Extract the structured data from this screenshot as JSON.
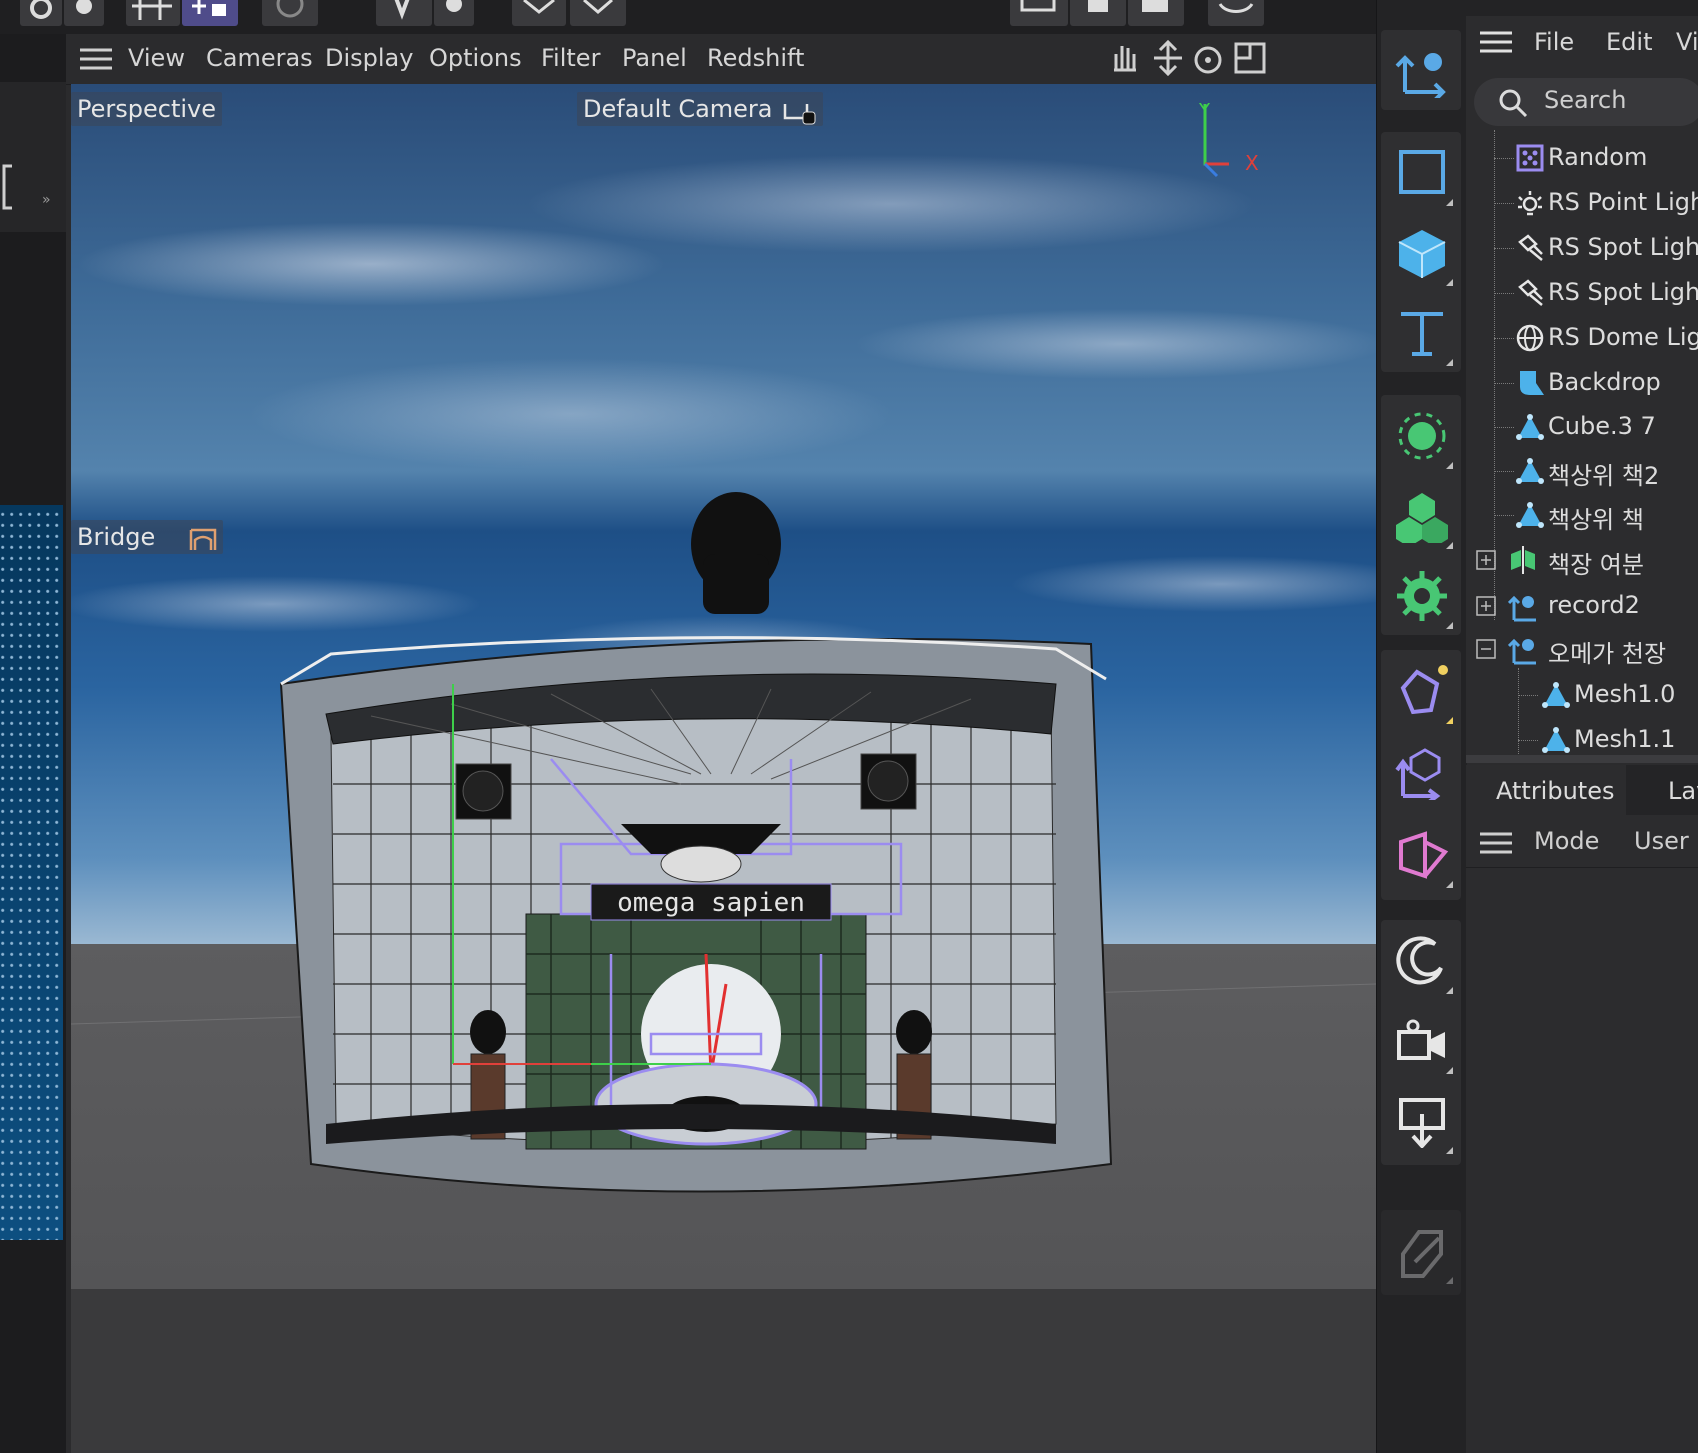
{
  "viewport_menu": {
    "items": [
      "View",
      "Cameras",
      "Display",
      "Options",
      "Filter",
      "Panel",
      "Redshift"
    ]
  },
  "viewport": {
    "projection_label": "Perspective",
    "camera_label": "Default Camera",
    "axis_y": "Y",
    "axis_x": "X",
    "bridge_label": "Bridge",
    "sign_text": "omega sapien"
  },
  "objects_panel": {
    "menu": {
      "file": "File",
      "edit": "Edit",
      "view": "Vi"
    },
    "search_placeholder": "Search",
    "items": [
      {
        "label": "Random",
        "icon": "random-icon"
      },
      {
        "label": "RS Point Ligh",
        "icon": "point-light-icon"
      },
      {
        "label": "RS Spot Light",
        "icon": "spot-light-icon"
      },
      {
        "label": "RS Spot Light",
        "icon": "spot-light-icon"
      },
      {
        "label": "RS Dome Lig",
        "icon": "dome-light-icon"
      },
      {
        "label": "Backdrop",
        "icon": "backdrop-icon"
      },
      {
        "label": "Cube.3 7",
        "icon": "polygon-object-icon"
      },
      {
        "label": "책상위 책2",
        "icon": "polygon-object-icon"
      },
      {
        "label": "책상위 책",
        "icon": "polygon-object-icon"
      },
      {
        "label": "책장 여분",
        "icon": "symmetry-icon"
      },
      {
        "label": "record2",
        "icon": "null-object-icon"
      },
      {
        "label": "오메가 천장",
        "icon": "null-object-icon"
      },
      {
        "label": "Mesh1.0",
        "icon": "polygon-object-icon"
      },
      {
        "label": "Mesh1.1",
        "icon": "polygon-object-icon"
      }
    ]
  },
  "attributes_panel": {
    "tabs": {
      "attributes": "Attributes",
      "layers": "Lay"
    },
    "mode_row": {
      "mode": "Mode",
      "user": "User D"
    }
  },
  "colors": {
    "accent_blue": "#5aa9e6",
    "object_icon_blue": "#4db2ea",
    "generator_green": "#48c774",
    "deformer_purple": "#9b8cf0",
    "axis_y": "#3ecf4a",
    "axis_x": "#e0403a"
  }
}
